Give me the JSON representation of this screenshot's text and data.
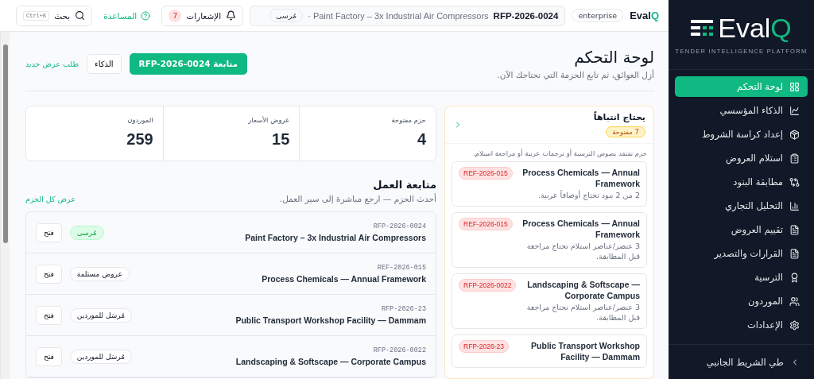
{
  "sidebar": {
    "logo": {
      "name": "Eval",
      "accent": "Q"
    },
    "tagline": "TENDER INTELLIGENCE PLATFORM",
    "items": [
      {
        "label": "لوحة التحكم",
        "selected": true
      },
      {
        "label": "الذكاء المؤسسي",
        "selected": false
      },
      {
        "label": "إعداد كراسة الشروط",
        "selected": false
      },
      {
        "label": "استلام العروض",
        "selected": false
      },
      {
        "label": "مطابقة البنود",
        "selected": false
      },
      {
        "label": "التحليل التجاري",
        "selected": false
      },
      {
        "label": "تقييم العروض",
        "selected": false
      },
      {
        "label": "القرارات والتصدير",
        "selected": false
      },
      {
        "label": "الترسية",
        "selected": false
      },
      {
        "label": "الموردون",
        "selected": false
      },
      {
        "label": "الإعدادات",
        "selected": false
      }
    ],
    "collapse": "طي الشريط الجانبي"
  },
  "topbar": {
    "brand": {
      "name": "Eval",
      "accent": "Q"
    },
    "plan": "enterprise",
    "context": {
      "ref": "RFP-2026-0024",
      "title": "· Paint Factory – 3x Industrial Air Compressors",
      "status": "مُرسى"
    },
    "notifications": {
      "label": "الإشعارات",
      "count": "7"
    },
    "help": "المساعدة",
    "search": {
      "label": "بحث",
      "shortcut": "Ctrl+K"
    }
  },
  "header": {
    "title": "لوحة التحكم",
    "subtitle": "أزل العوائق، ثم تابع الحزمة التي تحتاجك الآن.",
    "primary": "متابعة RFP-2026-0024",
    "secondary": "الذكاء",
    "link": "طلب عرض جديد"
  },
  "attention": {
    "title": "يحتاج انتباهاً",
    "count": "7 مفتوحة",
    "description": "حزم تفتقد نصوص الترسية أو ترجمات عربية أو مراجعة استلام.",
    "items": [
      {
        "title": "Process Chemicals — Annual Framework",
        "ref": "REF-2026-015",
        "detail": "2 من 2 بنود تحتاج أوصافاً عربية."
      },
      {
        "title": "Process Chemicals — Annual Framework",
        "ref": "REF-2026-015",
        "detail": "3 عنصر/عناصر استلام تحتاج مراجعة قبل المطابقة."
      },
      {
        "title": "Landscaping & Softscape — Corporate Campus",
        "ref": "RFP-2026-0022",
        "detail": "3 عنصر/عناصر استلام تحتاج مراجعة قبل المطابقة."
      },
      {
        "title": "Public Transport Workshop Facility — Dammam",
        "ref": "RFP-2026-23"
      }
    ]
  },
  "stats": [
    {
      "label": "حزم مفتوحة",
      "value": "4"
    },
    {
      "label": "عروض الأسعار",
      "value": "15"
    },
    {
      "label": "الموردون",
      "value": "259"
    }
  ],
  "work": {
    "title": "متابعة العمل",
    "subtitle": "أحدث الحزم — ارجع مباشرة إلى سير العمل.",
    "link": "عرض كل الحزم",
    "rows": [
      {
        "ref": "RFP-2026-0024",
        "title": "Paint Factory – 3x Industrial Air Compressors",
        "status": "مُرسى",
        "kind": "success",
        "action": "فتح"
      },
      {
        "ref": "REF-2026-015",
        "title": "Process Chemicals — Annual Framework",
        "status": "عروض مستلمة",
        "kind": "neutral",
        "action": "فتح"
      },
      {
        "ref": "RFP-2026-23",
        "title": "Public Transport Workshop Facility — Dammam",
        "status": "مُرسَل للموردين",
        "kind": "neutral",
        "action": "فتح"
      },
      {
        "ref": "RFP-2026-0022",
        "title": "Landscaping & Softscape — Corporate Campus",
        "status": "مُرسَل للموردين",
        "kind": "neutral",
        "action": "فتح"
      }
    ]
  }
}
